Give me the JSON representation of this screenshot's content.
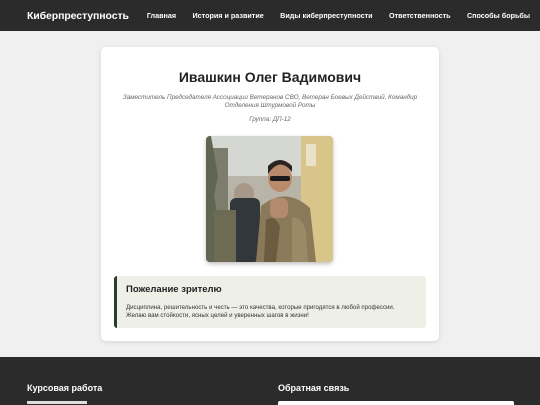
{
  "header": {
    "brand": "Киберпреступность",
    "nav": [
      "Главная",
      "История и развитие",
      "Виды киберпреступности",
      "Ответственность",
      "Способы борьбы"
    ]
  },
  "profile": {
    "name": "Ивашкин Олег Вадимович",
    "role": "Заместитель Председателя Ассоциации Ветеранов СВО, Ветеран Боевых Действий, Командир Отделения Штурмовой Роты",
    "group": "Группа: ДП-12"
  },
  "wish": {
    "title": "Пожелание зрителю",
    "text": "Дисциплина, решительность и честь — это качества, которые пригодятся в любой профессии. Желаю вам стойкости, ясных целей и уверенных шагов в жизни!"
  },
  "footer": {
    "left_title": "Курсовая работа",
    "right_title": "Обратная связь"
  }
}
